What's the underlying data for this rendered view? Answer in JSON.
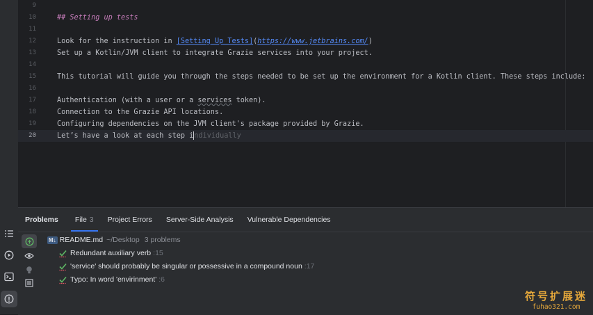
{
  "editor": {
    "lines": [
      {
        "num": "9",
        "segments": []
      },
      {
        "num": "10",
        "segments": [
          {
            "t": "## Setting up tests",
            "c": "md-head"
          }
        ]
      },
      {
        "num": "11",
        "segments": []
      },
      {
        "num": "12",
        "segments": [
          {
            "t": "Look for the instruction in "
          },
          {
            "t": "[Setting Up Tests]",
            "c": "md-link"
          },
          {
            "t": "("
          },
          {
            "t": "https://www.jetbrains.com/",
            "c": "md-url"
          },
          {
            "t": ")"
          }
        ]
      },
      {
        "num": "13",
        "segments": [
          {
            "t": "Set up a Kotlin/JVM client to integrate Grazie services into your project."
          }
        ]
      },
      {
        "num": "14",
        "segments": []
      },
      {
        "num": "15",
        "segments": [
          {
            "t": "This tutorial will guide you through the steps needed to be set up the environment for a Kotlin client. These steps include:"
          }
        ]
      },
      {
        "num": "16",
        "segments": []
      },
      {
        "num": "17",
        "segments": [
          {
            "t": "Authentication (with a user or a "
          },
          {
            "t": "services",
            "c": "squiggle"
          },
          {
            "t": " token)."
          }
        ]
      },
      {
        "num": "18",
        "segments": [
          {
            "t": "Connection to the Grazie API locations."
          }
        ]
      },
      {
        "num": "19",
        "segments": [
          {
            "t": "Configuring dependencies on the JVM client's package provided by Grazie."
          }
        ]
      },
      {
        "num": "20",
        "current": true,
        "segments": [
          {
            "t": "Let’s have a look at each step i"
          },
          {
            "caret": true
          },
          {
            "t": "ndividually",
            "c": "hint"
          }
        ]
      }
    ]
  },
  "problems": {
    "title": "Problems",
    "tabs": [
      {
        "label": "File",
        "count": "3",
        "selected": true
      },
      {
        "label": "Project Errors"
      },
      {
        "label": "Server-Side Analysis"
      },
      {
        "label": "Vulnerable Dependencies"
      }
    ],
    "file": {
      "icon_text": "M↓",
      "name": "README.md",
      "path": "~/Desktop",
      "summary": "3 problems"
    },
    "items": [
      {
        "text": "Redundant auxiliary verb",
        "line": ":15"
      },
      {
        "text": "'service' should probably be singular or possessive in a compound noun",
        "line": ":17"
      },
      {
        "text": "Typo: In word 'envirinment'",
        "line": ":6"
      }
    ]
  },
  "watermark": {
    "line1": "符号扩展迷",
    "line2": "fuhao321.com"
  },
  "colors": {
    "accent": "#3574f0",
    "check": "#5fb865",
    "heading": "#c77dbb",
    "link": "#548af7"
  }
}
